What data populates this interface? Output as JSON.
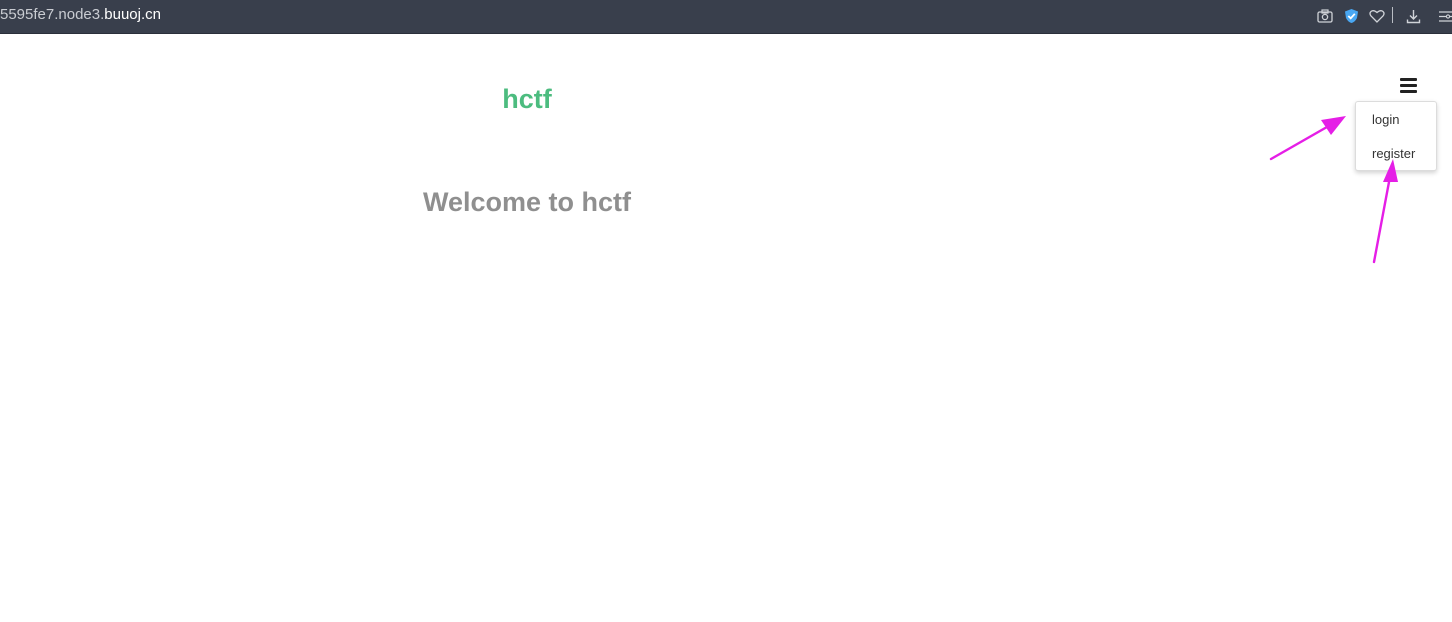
{
  "browser": {
    "url_path": "5595fe7.node3.",
    "url_host": "buuoj.cn"
  },
  "page": {
    "brand": "hctf",
    "welcome": "Welcome to hctf"
  },
  "menu": {
    "items": [
      {
        "label": "login"
      },
      {
        "label": "register"
      }
    ]
  },
  "colors": {
    "brand": "#4cbc7f",
    "annotation_arrow": "#e51ee6",
    "toolbar": "#393f4c"
  },
  "icons": [
    "camera-icon",
    "shield-check-icon",
    "heart-icon",
    "download-icon",
    "menu-lines-icon",
    "hamburger-icon"
  ]
}
